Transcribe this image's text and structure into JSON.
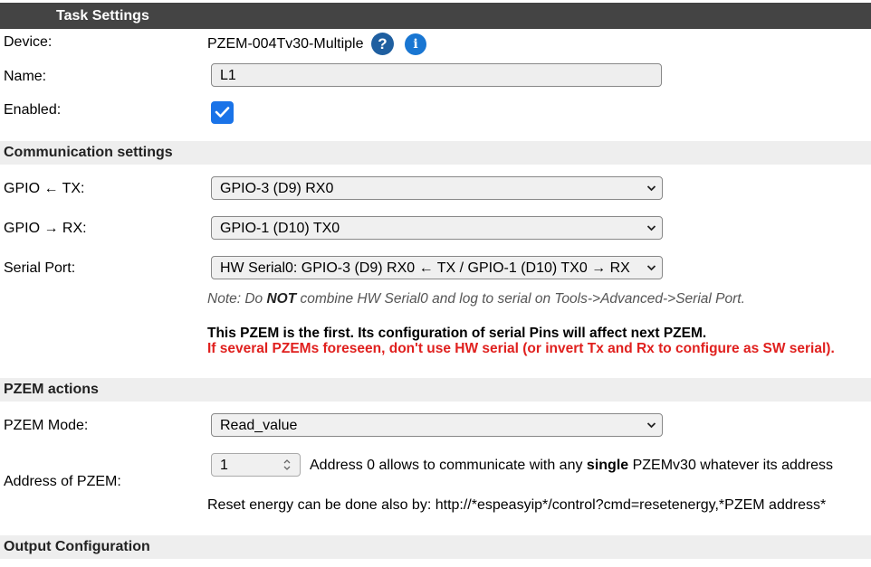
{
  "header": {
    "title": "Task Settings"
  },
  "device": {
    "label": "Device:",
    "value": "PZEM-004Tv30-Multiple",
    "help_icon": "question-icon",
    "info_icon": "info-icon"
  },
  "name": {
    "label": "Name:",
    "value": "L1"
  },
  "enabled": {
    "label": "Enabled:",
    "checked": true
  },
  "communication": {
    "title": "Communication settings",
    "gpio_tx": {
      "label": "GPIO ← TX:",
      "value": "GPIO-3 (D9) RX0"
    },
    "gpio_rx": {
      "label": "GPIO → RX:",
      "value": "GPIO-1 (D10) TX0"
    },
    "serial_port": {
      "label": "Serial Port:",
      "value": "HW Serial0: GPIO-3 (D9) RX0 ← TX / GPIO-1 (D10) TX0 → RX"
    },
    "note_prefix": "Note: Do ",
    "note_bold": "NOT",
    "note_suffix": " combine HW Serial0 and log to serial on Tools->Advanced->Serial Port.",
    "warning_first": "This PZEM is the first. Its configuration of serial Pins will affect next PZEM.",
    "warning_several": "If several PZEMs foreseen, don't use HW serial (or invert Tx and Rx to configure as SW serial)."
  },
  "pzem_actions": {
    "title": "PZEM actions",
    "mode": {
      "label": "PZEM Mode:",
      "value": "Read_value"
    },
    "address": {
      "label": "Address of PZEM:",
      "value": "1",
      "hint_prefix": "Address 0 allows to communicate with any ",
      "hint_bold": "single",
      "hint_suffix": " PZEMv30 whatever its address"
    },
    "reset_text": "Reset energy can be done also by: http://*espeasyip*/control?cmd=resetenergy,*PZEM address*"
  },
  "output": {
    "title": "Output Configuration"
  },
  "colors": {
    "header_bg": "#444444",
    "section_bg": "#eeeeee",
    "accent": "#1a73e8",
    "warning": "#e0201e"
  }
}
